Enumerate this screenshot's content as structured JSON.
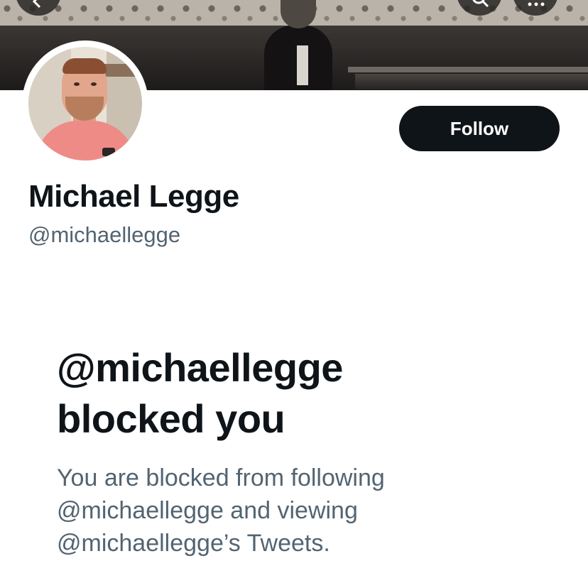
{
  "profile": {
    "display_name": "Michael Legge",
    "handle": "@michaellegge",
    "follow_label": "Follow"
  },
  "blocked_notice": {
    "title_line1": "@michaellegge",
    "title_line2": "blocked you",
    "desc_line1": "You are blocked from following",
    "desc_line2": "@michaellegge and viewing",
    "desc_line3": "@michaellegge’s Tweets."
  },
  "banner_buttons": [
    "back-icon",
    "search-icon",
    "more-icon"
  ],
  "colors": {
    "primary_text": "#0f1419",
    "secondary_text": "#536471",
    "follow_button_bg": "#0f1419",
    "follow_button_text": "#ffffff"
  }
}
